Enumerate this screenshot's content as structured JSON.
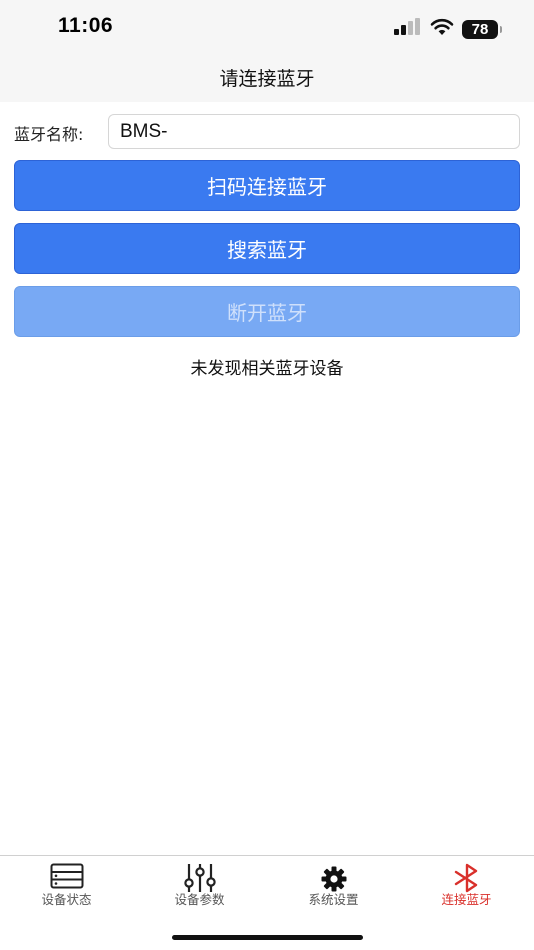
{
  "status_bar": {
    "time": "11:06",
    "battery": "78"
  },
  "nav": {
    "title": "请连接蓝牙"
  },
  "form": {
    "name_label": "蓝牙名称:",
    "name_value": "BMS-"
  },
  "buttons": {
    "scan_connect": "扫码连接蓝牙",
    "search": "搜索蓝牙",
    "disconnect": "断开蓝牙"
  },
  "message": "未发现相关蓝牙设备",
  "tabs": [
    {
      "label": "设备状态",
      "icon": "device-status-icon",
      "active": false
    },
    {
      "label": "设备参数",
      "icon": "sliders-icon",
      "active": false
    },
    {
      "label": "系统设置",
      "icon": "gear-icon",
      "active": false
    },
    {
      "label": "连接蓝牙",
      "icon": "bluetooth-icon",
      "active": true
    }
  ],
  "colors": {
    "primary_button": "#3a7af0",
    "disabled_button": "#78a9f4",
    "active_tab": "#d9302b"
  }
}
